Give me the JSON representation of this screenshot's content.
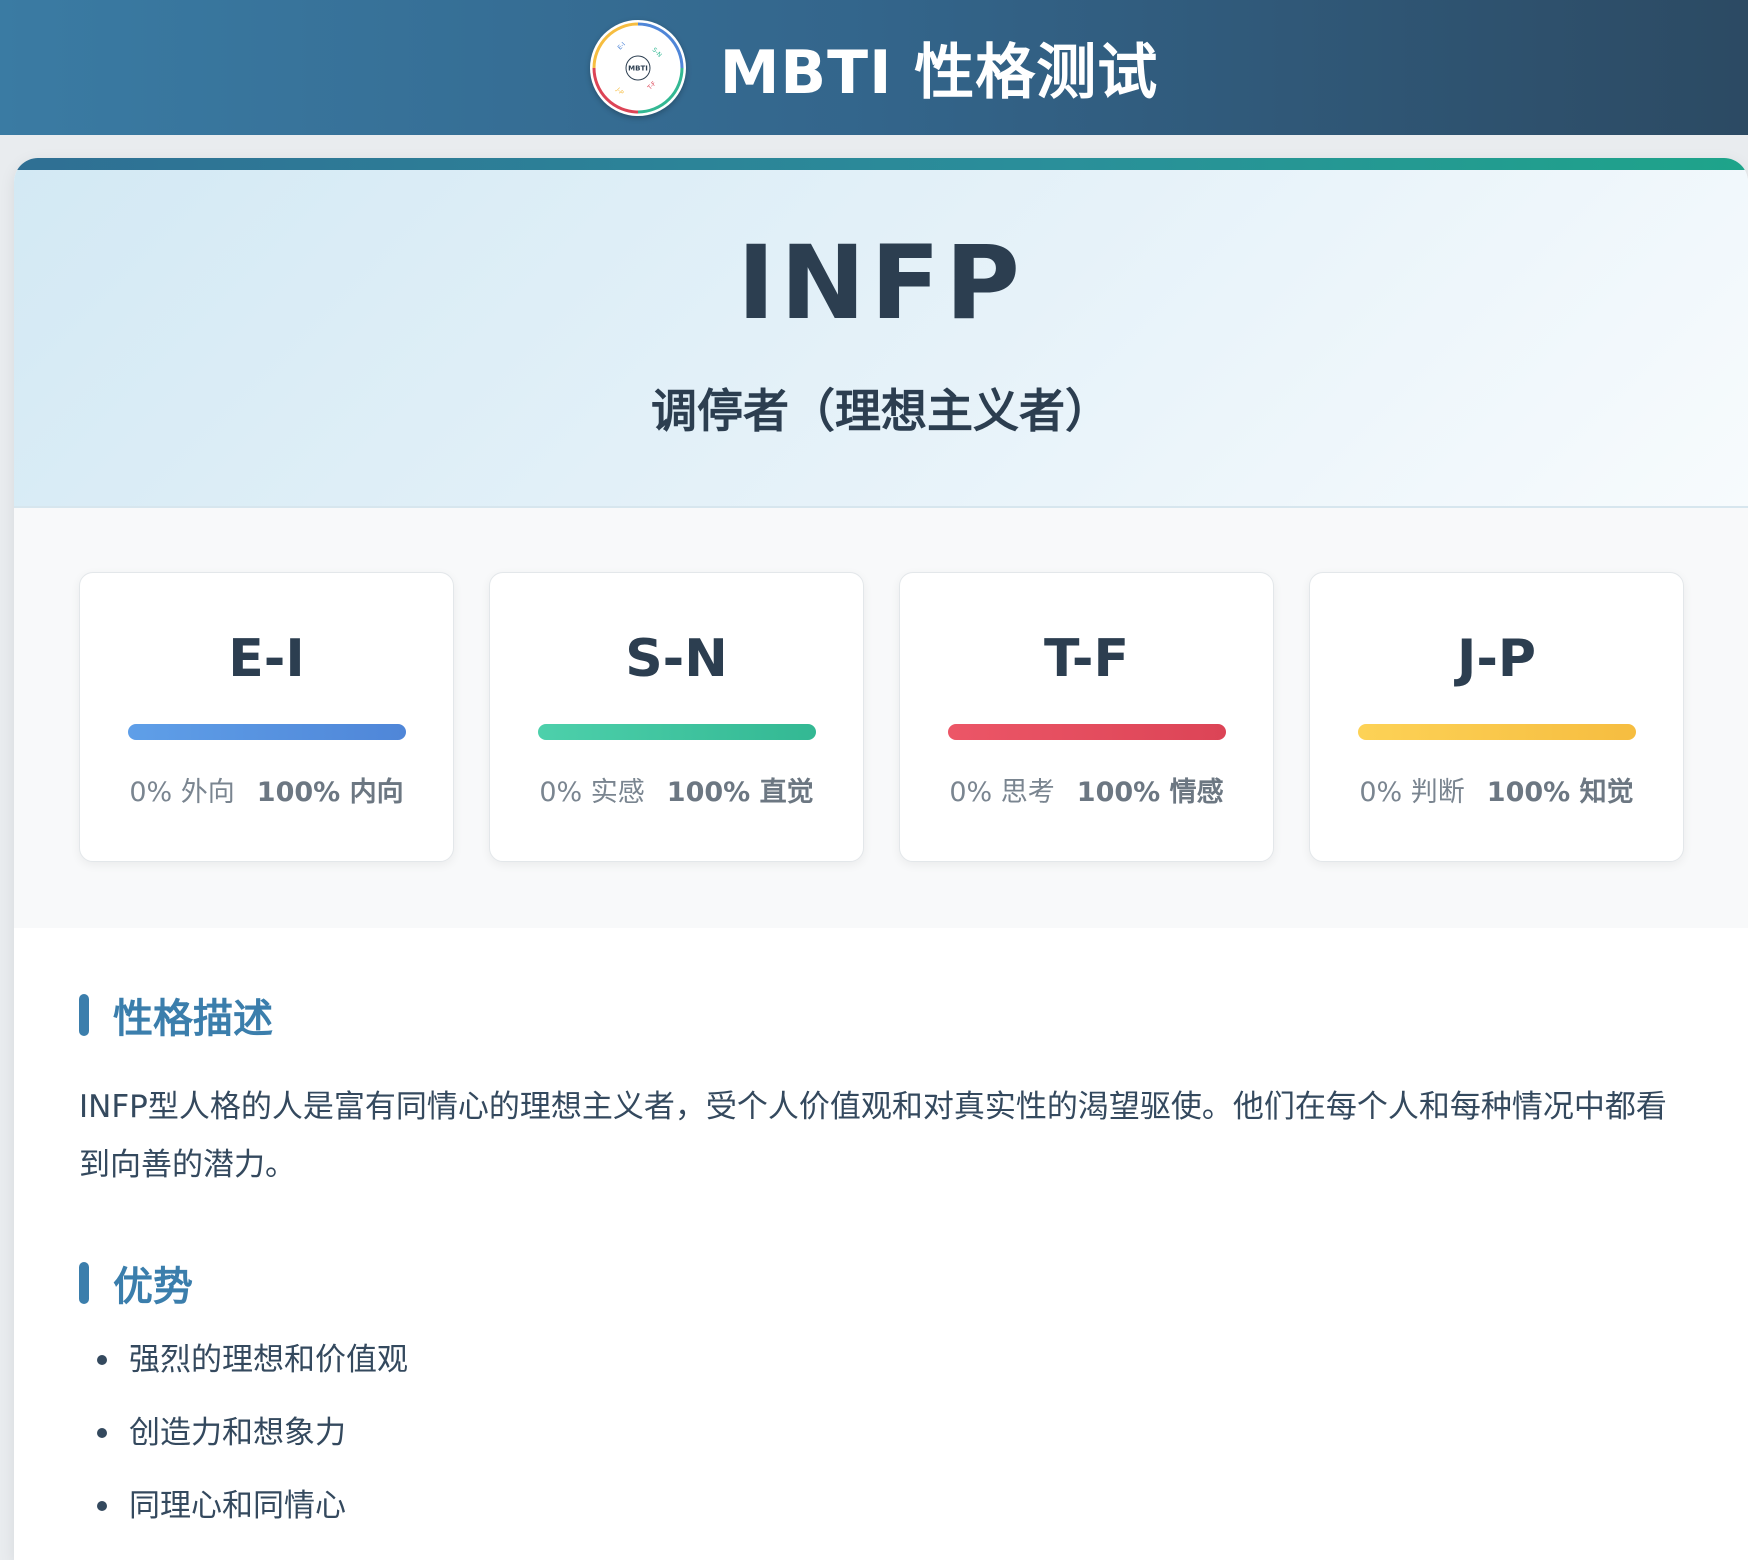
{
  "header": {
    "title": "MBTI 性格测试",
    "logo": {
      "center_text": "MBTI",
      "ring_labels": [
        "E-I",
        "S-N",
        "T-F",
        "J-P"
      ],
      "ring_colors": [
        "#4f86d8",
        "#33b893",
        "#dc4456",
        "#f6bd40"
      ]
    }
  },
  "result": {
    "type_code": "INFP",
    "type_name": "调停者（理想主义者）"
  },
  "dimensions": [
    {
      "label": "E-I",
      "left_value": "0% 外向",
      "right_value": "100% 内向",
      "color": "#4f86d8"
    },
    {
      "label": "S-N",
      "left_value": "0% 实感",
      "right_value": "100% 直觉",
      "color": "#33b893"
    },
    {
      "label": "T-F",
      "left_value": "0% 思考",
      "right_value": "100% 情感",
      "color": "#dc4456"
    },
    {
      "label": "J-P",
      "left_value": "0% 判断",
      "right_value": "100% 知觉",
      "color": "#f6bd40"
    }
  ],
  "description": {
    "title": "性格描述",
    "text": "INFP型人格的人是富有同情心的理想主义者，受个人价值观和对真实性的渴望驱使。他们在每个人和每种情况中都看到向善的潜力。"
  },
  "strengths": {
    "title": "优势",
    "items": [
      "强烈的理想和价值观",
      "创造力和想象力",
      "同理心和同情心"
    ]
  },
  "colors": {
    "accent": "#3b7eac",
    "header_start": "#3a7ba3",
    "header_end": "#2c4a63",
    "text_dark": "#2c3e50"
  }
}
